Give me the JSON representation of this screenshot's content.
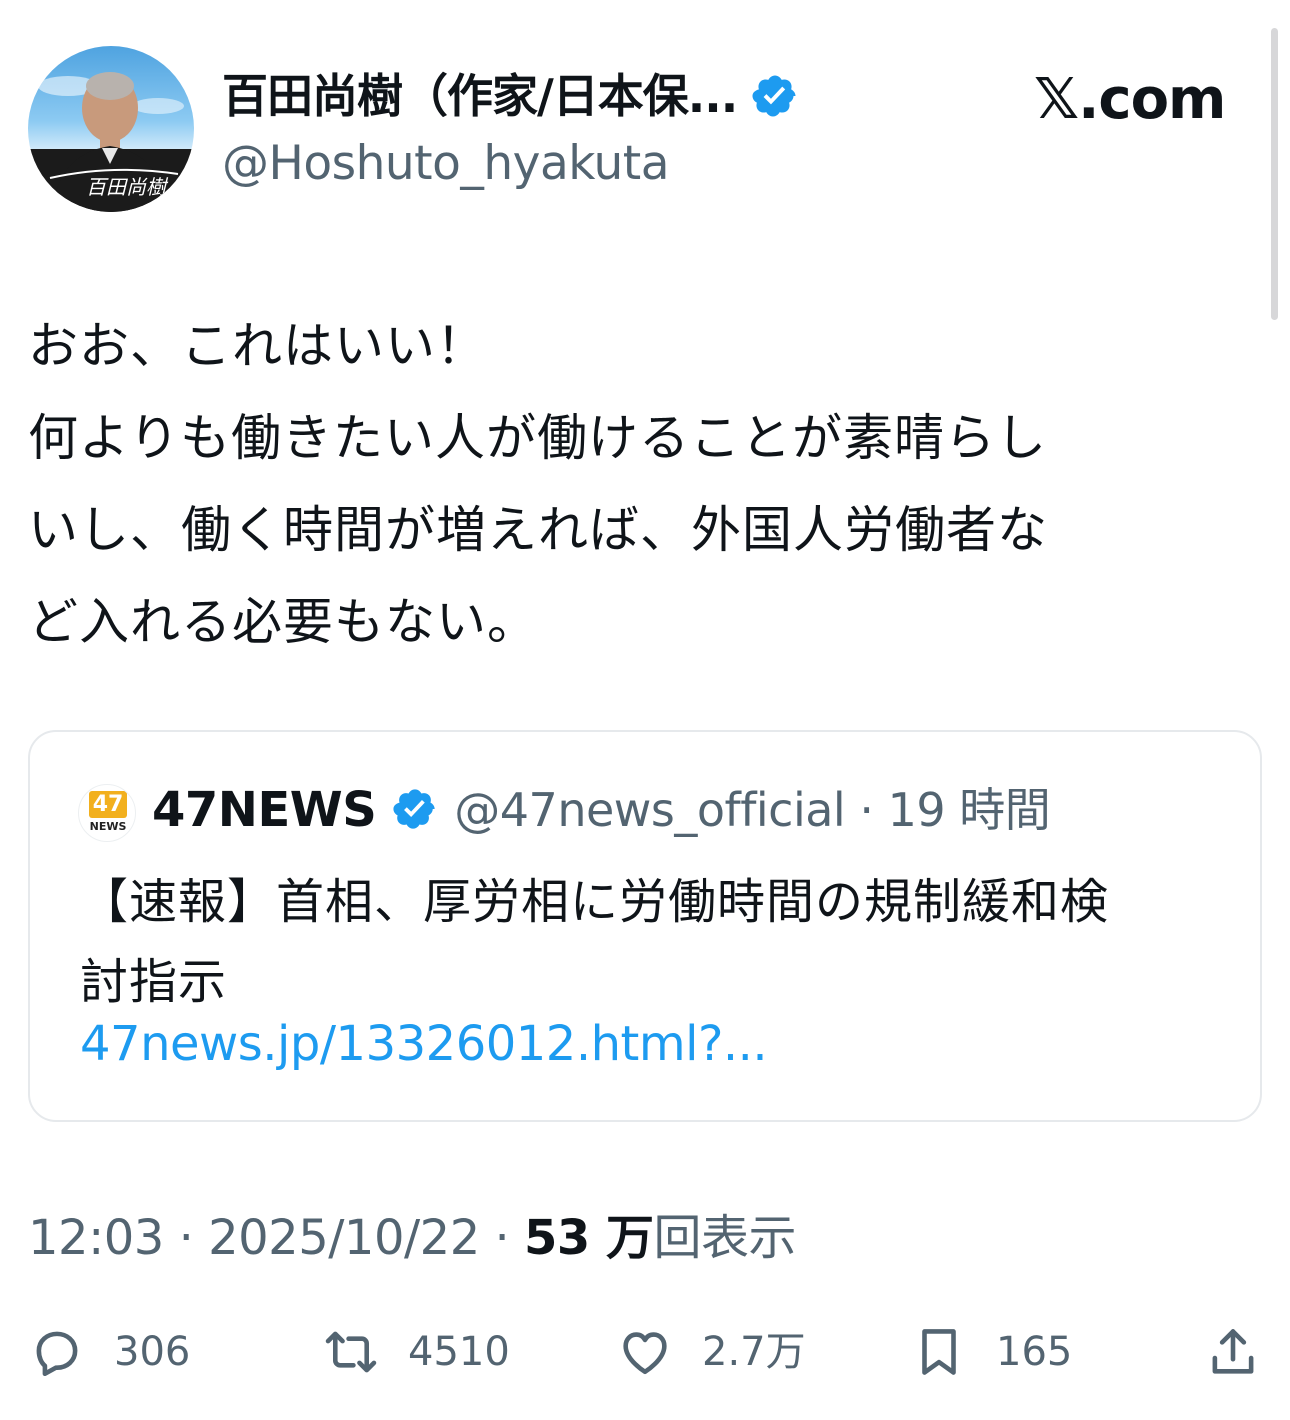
{
  "header": {
    "display_name": "百田尚樹（作家/日本保...",
    "handle": "@Hoshuto_hyakuta",
    "brand": "𝕏.com",
    "avatar_caption": "百田尚樹"
  },
  "tweet": {
    "lines": [
      "おお、これはいい！",
      "何よりも働きたい人が働けることが素晴らし",
      "いし、働く時間が増えれば、外国人労働者な",
      "ど入れる必要もない。"
    ]
  },
  "quote": {
    "logo_number": "47",
    "logo_text": "NEWS",
    "name": "47NEWS",
    "handle_time": "@47news_official · 19 時間",
    "lines": [
      "【速報】首相、厚労相に労働時間の規制緩和検",
      "討指示"
    ],
    "link": "47news.jp/13326012.html?..."
  },
  "meta": {
    "time_date": "12:03 · 2025/10/22 · ",
    "views_count": "53 万",
    "views_label": "回表示"
  },
  "actions": {
    "replies": "306",
    "reposts": "4510",
    "likes": "2.7万",
    "bookmarks": "165"
  },
  "colors": {
    "text": "#0f1419",
    "muted": "#536471",
    "link": "#1d9bf0",
    "verified": "#1d9bf0",
    "border": "#e6e9ec"
  },
  "icons": {
    "verified": "verified-badge-icon",
    "reply": "reply-bubble-icon",
    "repost": "repost-arrows-icon",
    "like": "heart-icon",
    "bookmark": "bookmark-icon",
    "share": "share-upload-icon"
  }
}
